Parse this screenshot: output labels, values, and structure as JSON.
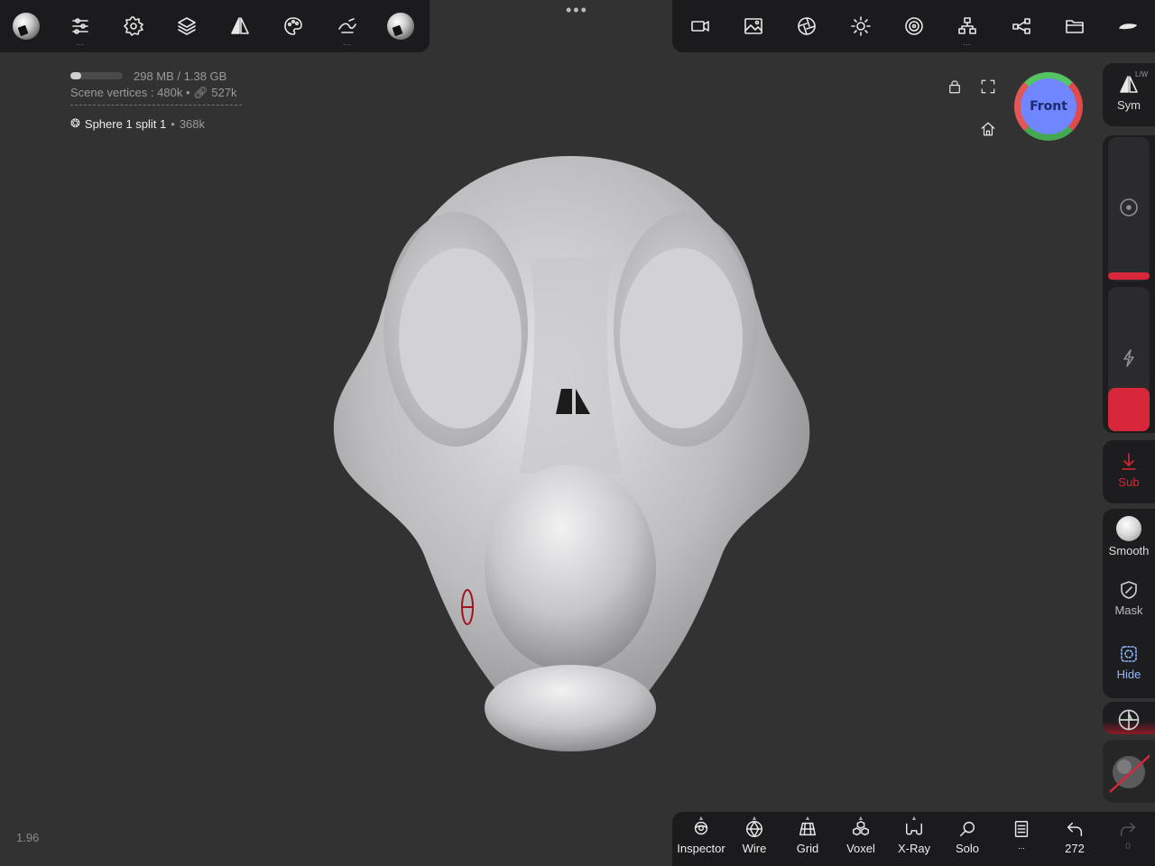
{
  "toolbar_top_left": {
    "items": [
      {
        "name": "project-sphere-icon"
      },
      {
        "name": "tool-settings-icon",
        "more": "..."
      },
      {
        "name": "settings-gear-icon"
      },
      {
        "name": "layers-icon"
      },
      {
        "name": "symmetry-icon"
      },
      {
        "name": "palette-icon"
      },
      {
        "name": "stroke-icon",
        "more": "..."
      },
      {
        "name": "material-sphere-icon"
      }
    ]
  },
  "more_menu": "•••",
  "toolbar_top_right": {
    "items": [
      {
        "name": "camera-icon"
      },
      {
        "name": "background-image-icon"
      },
      {
        "name": "render-shading-icon"
      },
      {
        "name": "light-icon"
      },
      {
        "name": "matcap-icon"
      },
      {
        "name": "scene-tree-icon",
        "more": "..."
      },
      {
        "name": "share-icon"
      },
      {
        "name": "files-icon"
      },
      {
        "name": "app-menu-icon"
      }
    ]
  },
  "info": {
    "memory_text": "298 MB / 1.38 GB",
    "memory_fraction": 0.21,
    "vertices_label": "Scene vertices :",
    "vertices_value": "480k",
    "vertices_sep": "•",
    "vertices_linked": "527k",
    "object_name": "Sphere 1 split 1",
    "object_sep": "•",
    "object_count": "368k"
  },
  "view_gizmo": {
    "face": "Front",
    "colors": {
      "x": "#e04a4a",
      "y": "#55c462",
      "z": "#6f86ff"
    }
  },
  "right_sidebar": {
    "sym_label": "Sym",
    "sym_hint": "L/W",
    "sub_label": "Sub",
    "smooth_label": "Smooth",
    "mask_label": "Mask",
    "hide_label": "Hide",
    "accent_color": "#d8263a"
  },
  "bottom_bar": {
    "items": [
      {
        "label": "Inspector"
      },
      {
        "label": "Wire"
      },
      {
        "label": "Grid"
      },
      {
        "label": "Voxel"
      },
      {
        "label": "X-Ray"
      },
      {
        "label": "Solo"
      },
      {
        "label": "..."
      },
      {
        "label": "272"
      },
      {
        "label": "0"
      }
    ]
  },
  "zoom_readout": "1.96"
}
